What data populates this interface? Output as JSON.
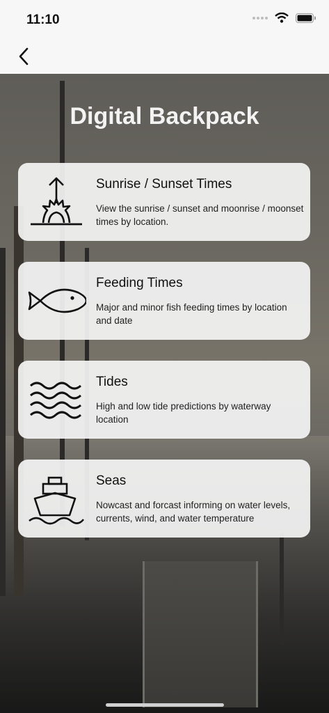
{
  "status": {
    "time": "11:10"
  },
  "nav": {
    "back_icon": "chevron-left-icon"
  },
  "page": {
    "title": "Digital Backpack"
  },
  "cards": [
    {
      "title": "Sunrise / Sunset Times",
      "description": "View the sunrise / sunset and moonrise / moonset times by location.",
      "icon": "sunrise-icon"
    },
    {
      "title": "Feeding Times",
      "description": "Major and minor fish feeding times by location and date",
      "icon": "fish-icon"
    },
    {
      "title": "Tides",
      "description": "High and low tide predictions by waterway location",
      "icon": "waves-icon"
    },
    {
      "title": "Seas",
      "description": "Nowcast and forcast informing on water levels, currents, wind, and water temperature",
      "icon": "ship-icon"
    }
  ]
}
